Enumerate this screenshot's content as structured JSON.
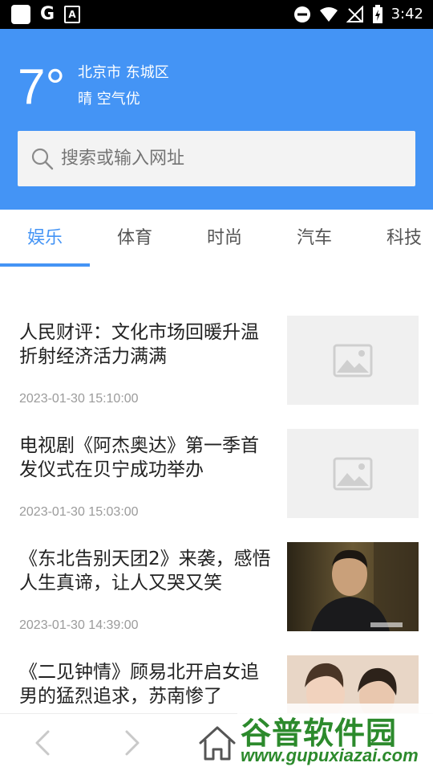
{
  "status_bar": {
    "time": "3:42",
    "icons": [
      "app-square-icon",
      "google-icon",
      "font-a-icon",
      "do-not-disturb-icon",
      "wifi-icon",
      "no-signal-icon",
      "battery-charging-icon"
    ],
    "g_letter": "G",
    "a_letter": "A"
  },
  "header": {
    "temperature": "7°",
    "location": "北京市 东城区",
    "weather": "晴 空气优",
    "search_placeholder": "搜索或输入网址",
    "accent_color": "#4494f5"
  },
  "tabs": [
    {
      "label": "娱乐",
      "active": true
    },
    {
      "label": "体育",
      "active": false
    },
    {
      "label": "时尚",
      "active": false
    },
    {
      "label": "汽车",
      "active": false
    },
    {
      "label": "科技",
      "active": false
    }
  ],
  "articles": [
    {
      "title": "人民财评：文化市场回暖升温折射经济活力满满",
      "time": "2023-01-30 15:10:00",
      "image": "placeholder-image-icon"
    },
    {
      "title": "电视剧《阿杰奥达》第一季首发仪式在贝宁成功举办",
      "time": "2023-01-30 15:03:00",
      "image": "placeholder-image-icon"
    },
    {
      "title": "《东北告别天团2》来袭，感悟人生真谛，让人又哭又笑",
      "time": "2023-01-30 14:39:00",
      "image": "photo-man"
    },
    {
      "title": "《二见钟情》顾易北开启女追男的猛烈追求，苏南惨了",
      "time": "",
      "image": "photo-couple"
    }
  ],
  "bottom_nav": {
    "icons": [
      "back-arrow-icon",
      "forward-arrow-icon",
      "home-icon"
    ]
  },
  "watermark": {
    "name": "谷普软件园",
    "url": "www.gupuxiazai.com"
  }
}
